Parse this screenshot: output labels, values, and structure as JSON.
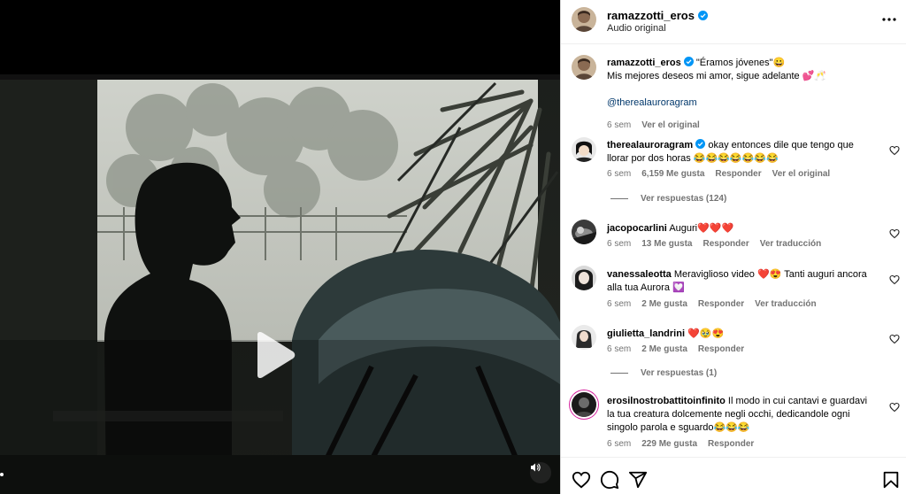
{
  "post": {
    "author": "ramazzotti_eros",
    "audio": "Audio original"
  },
  "caption": {
    "author": "ramazzotti_eros",
    "line1": "\"Éramos jóvenes\"😀",
    "line2": "Mis mejores deseos mi amor, sigue adelante 💕🥂",
    "mention": "@therealauroragram",
    "time": "6 sem",
    "see_original": "Ver el original"
  },
  "comments": [
    {
      "user": "therealauroragram",
      "verified": true,
      "text": "okay entonces dile que tengo que llorar por dos horas 😂😂😂😂😂😂😂",
      "time": "6 sem",
      "likes": "6,159 Me gusta",
      "reply": "Responder",
      "extra": "Ver el original",
      "replies": "Ver respuestas (124)"
    },
    {
      "user": "jacopocarlini",
      "text": "Auguri❤️❤️❤️",
      "time": "6 sem",
      "likes": "13 Me gusta",
      "reply": "Responder",
      "extra": "Ver traducción"
    },
    {
      "user": "vanessaleotta",
      "text": "Meraviglioso video ❤️😍 Tanti auguri ancora alla tua Aurora 💟",
      "time": "6 sem",
      "likes": "2 Me gusta",
      "reply": "Responder",
      "extra": "Ver traducción"
    },
    {
      "user": "giulietta_landrini",
      "text": "❤️🥹😍",
      "time": "6 sem",
      "likes": "2 Me gusta",
      "reply": "Responder",
      "replies": "Ver respuestas (1)"
    },
    {
      "user": "erosilnostrobattitoinfinito",
      "text": "Il modo in cui cantavi e guardavi la tua creatura dolcemente negli occhi, dedicandole ogni singolo parola e sguardo😂😂😂",
      "time": "6 sem",
      "likes": "229 Me gusta",
      "reply": "Responder"
    }
  ],
  "icons": {
    "verified": "verified-badge-icon",
    "more": "more-options-icon",
    "like": "heart-icon",
    "comment": "comment-icon",
    "share": "share-icon",
    "save": "bookmark-icon",
    "play": "play-icon",
    "sound": "sound-icon"
  },
  "colors": {
    "verified": "#0095f6",
    "mention": "#00376b",
    "secondary_text": "#737373"
  }
}
